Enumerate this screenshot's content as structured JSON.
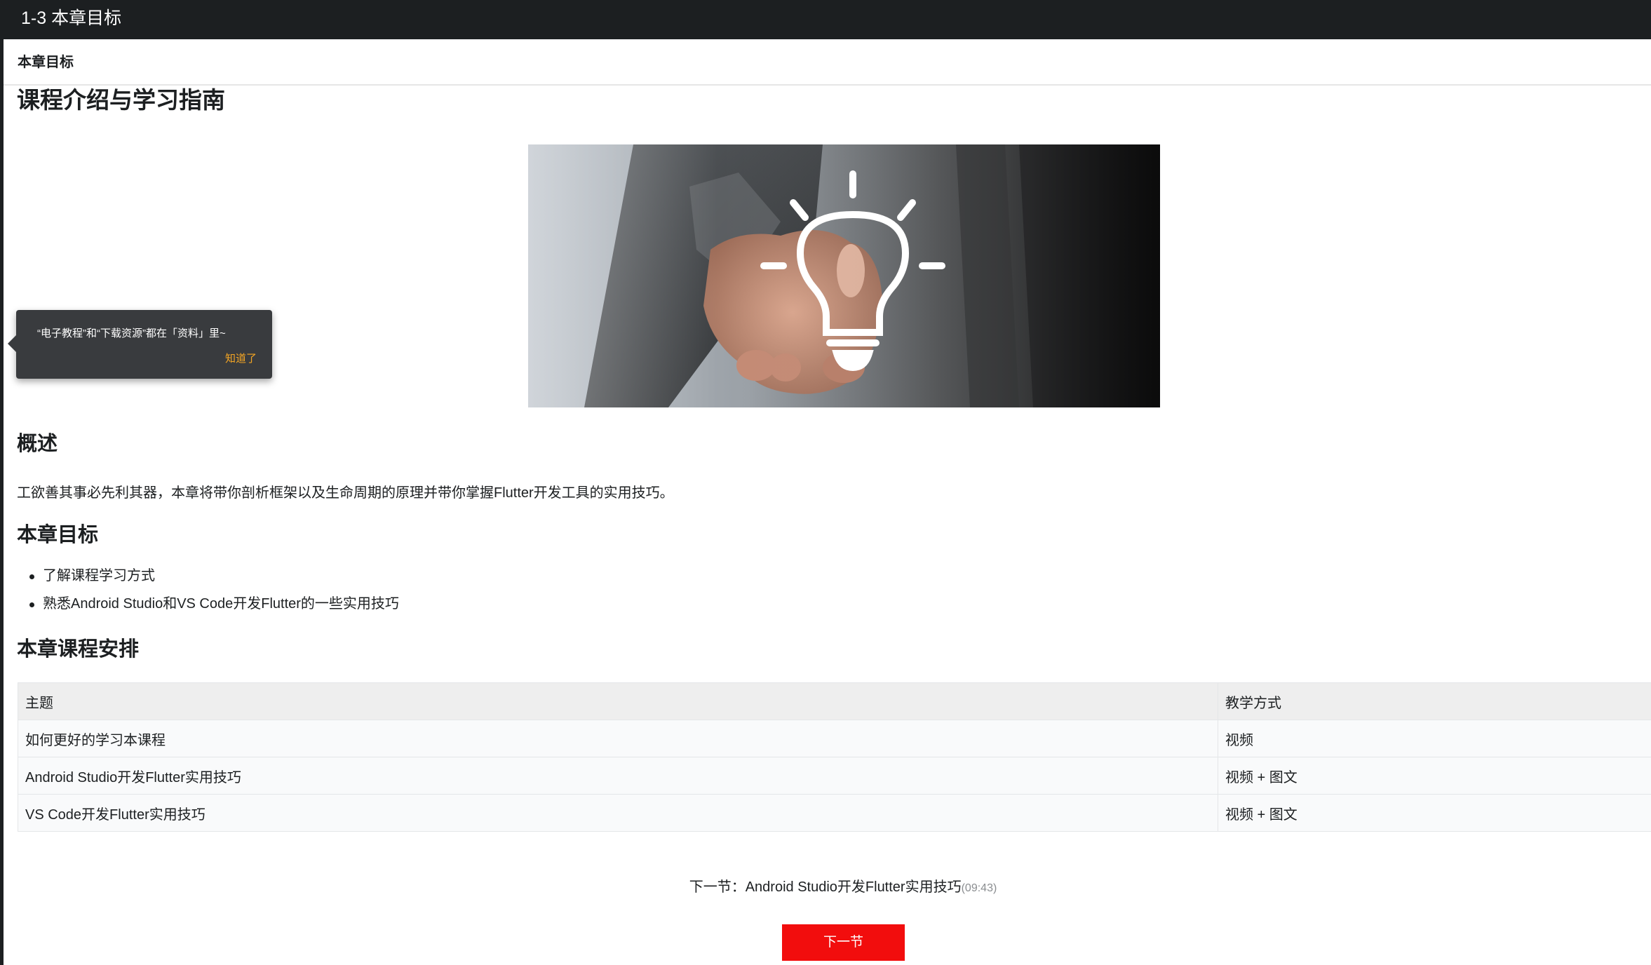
{
  "window": {
    "title": "1-3 本章目标"
  },
  "chapter_bar": {
    "label": "本章目标"
  },
  "article": {
    "title": "课程介绍与学习指南",
    "overview_heading": "概述",
    "overview_text": "工欲善其事必先利其器，本章将带你剖析框架以及生命周期的原理并带你掌握Flutter开发工具的实用技巧。",
    "goals_heading": "本章目标",
    "goals": [
      "了解课程学习方式",
      "熟悉Android Studio和VS Code开发Flutter的一些实用技巧"
    ],
    "schedule_heading": "本章课程安排",
    "schedule": {
      "headers": [
        "主题",
        "教学方式"
      ],
      "rows": [
        [
          "如何更好的学习本课程",
          "视频"
        ],
        [
          "Android Studio开发Flutter实用技巧",
          "视频 + 图文"
        ],
        [
          "VS Code开发Flutter实用技巧",
          "视频 + 图文"
        ]
      ]
    }
  },
  "tooltip": {
    "message": "“电子教程”和“下载资源”都在「资料」里~",
    "ok_label": "知道了"
  },
  "next": {
    "prefix": "下一节：",
    "title": "Android Studio开发Flutter实用技巧",
    "duration": "(09:43)",
    "button_label": "下一节"
  },
  "colors": {
    "titlebar_bg": "#1c1f21",
    "tooltip_bg": "#393b3e",
    "tooltip_action": "#f5a623",
    "next_button_bg": "#f20d0d",
    "table_header_bg": "#eeeeee"
  },
  "icons": {
    "hero": "lightbulb-icon"
  }
}
